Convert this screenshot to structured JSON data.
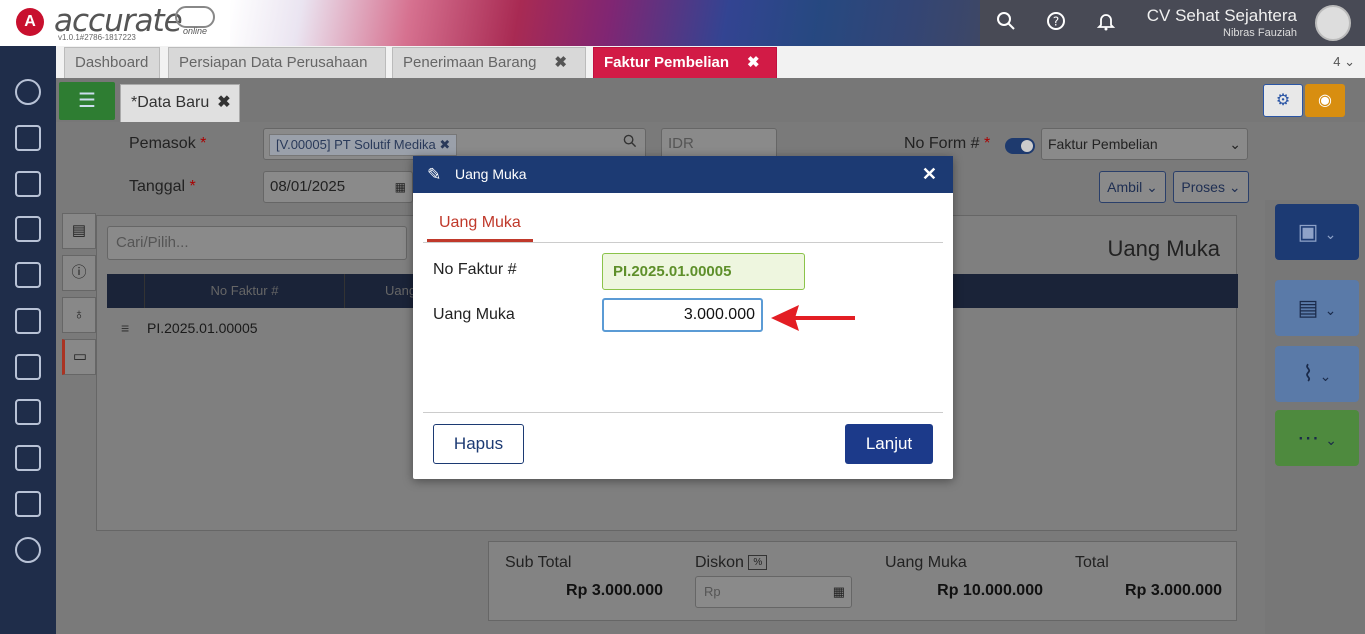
{
  "app": {
    "logo_letter": "A",
    "logo_text": "accurate",
    "logo_sub": "online",
    "version": "v1.0.1#2786-1817223",
    "company": "CV Sehat Sejahtera",
    "user": "Nibras Fauziah"
  },
  "tabs": [
    {
      "label": "Dashboard",
      "closable": false,
      "active": false
    },
    {
      "label": "Persiapan Data Perusahaan",
      "closable": false,
      "active": false
    },
    {
      "label": "Penerimaan Barang",
      "closable": true,
      "active": false
    },
    {
      "label": "Faktur Pembelian",
      "closable": true,
      "active": true
    }
  ],
  "tab_count": "4",
  "tab_close_glyph": "✖",
  "doc_tab": {
    "label": "*Data Baru",
    "close": "✖"
  },
  "form": {
    "pemasok_label": "Pemasok",
    "required_mark": "*",
    "pemasok_value": "[V.00005] PT Solutif Medika",
    "currency": "IDR",
    "tanggal_label": "Tanggal",
    "tanggal_value": "08/01/2025",
    "noform_label": "No Form #",
    "noform_type": "Faktur Pembelian",
    "ambil_label": "Ambil",
    "proses_label": "Proses",
    "search_placeholder": "Cari/Pilih...",
    "section_title": "Uang Muka",
    "table_headers": [
      "No Faktur #",
      "Uang"
    ],
    "rows": [
      {
        "no_faktur": "PI.2025.01.00005"
      }
    ]
  },
  "summary": {
    "subtotal_label": "Sub Total",
    "subtotal_value": "Rp 3.000.000",
    "diskon_label": "Diskon",
    "diskon_badge": "%",
    "diskon_placeholder": "Rp",
    "uangmuka_label": "Uang Muka",
    "uangmuka_value": "Rp 10.000.000",
    "total_label": "Total",
    "total_value": "Rp 3.000.000"
  },
  "modal": {
    "title": "Uang Muka",
    "tab": "Uang Muka",
    "no_faktur_label": "No Faktur #",
    "no_faktur_value": "PI.2025.01.00005",
    "uang_muka_label": "Uang Muka",
    "uang_muka_value": "3.000.000",
    "hapus_label": "Hapus",
    "lanjut_label": "Lanjut"
  },
  "colors": {
    "brand_red": "#c8102e",
    "modal_header": "#1c3a73",
    "active_tab": "#d21b46",
    "arrow": "#e31e24"
  }
}
